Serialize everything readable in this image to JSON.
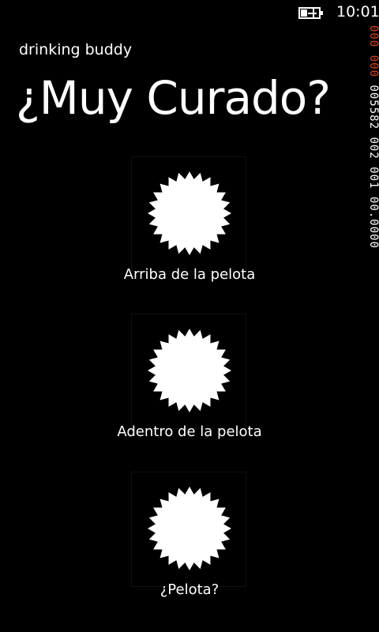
{
  "status_bar": {
    "time": "10:01",
    "battery_icon": "battery-charging-icon"
  },
  "fps_counter": {
    "line_a": "000 000",
    "line_b": "005582 002 001 00.0000"
  },
  "app": {
    "title": "drinking buddy",
    "page_title": "¿Muy Curado?"
  },
  "options": [
    {
      "label": "Arriba de la pelota",
      "icon": "starburst-icon"
    },
    {
      "label": "Adentro de la pelota",
      "icon": "starburst-icon"
    },
    {
      "label": "¿Pelota?",
      "icon": "starburst-icon"
    }
  ],
  "colors": {
    "background": "#000000",
    "foreground": "#ffffff",
    "counter_accent": "#d9421f"
  }
}
